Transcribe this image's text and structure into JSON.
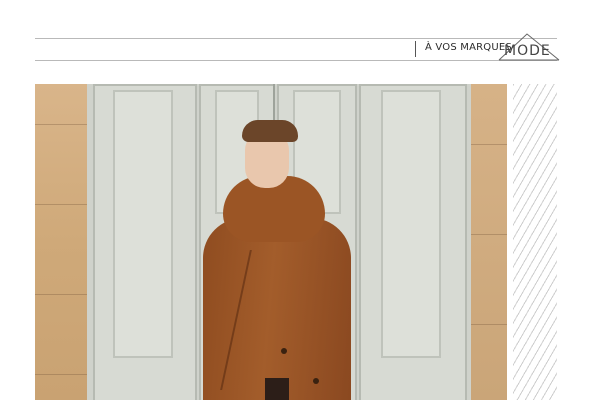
{
  "header": {
    "section_label": "À VOS MARQUES",
    "logo_text": "MODE"
  },
  "photo": {
    "subject": "model in rust-brown wool coat with oversized collar standing before pale grey double doors"
  },
  "colors": {
    "coat": "#9b5525",
    "door": "#d7dad3",
    "stone": "#d6b287",
    "rule": "#b9b9b9"
  }
}
